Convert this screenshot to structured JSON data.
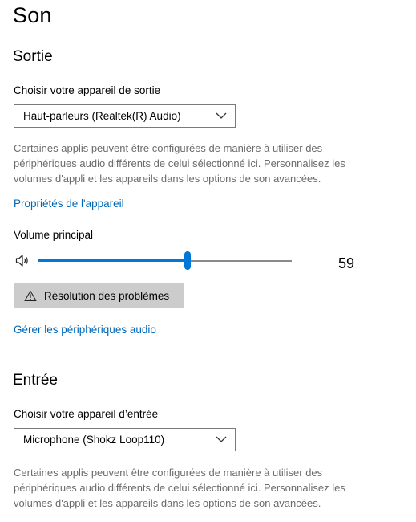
{
  "page": {
    "title": "Son"
  },
  "output": {
    "section_title": "Sortie",
    "device_label": "Choisir votre appareil de sortie",
    "device_value": "Haut-parleurs (Realtek(R) Audio)",
    "description": "Certaines applis peuvent être configurées de manière à utiliser des périphériques audio différents de celui sélectionné ici. Personnalisez les volumes d'appli et les appareils dans les options de son avancées.",
    "properties_link": "Propriétés de l'appareil",
    "volume_label": "Volume principal",
    "volume_value": "59",
    "volume_fraction": 0.59,
    "troubleshoot_label": "Résolution des problèmes",
    "manage_link": "Gérer les périphériques audio"
  },
  "input": {
    "section_title": "Entrée",
    "device_label": "Choisir votre appareil d’entrée",
    "device_value": "Microphone (Shokz Loop110)",
    "description": "Certaines applis peuvent être configurées de manière à utiliser des périphériques audio différents de celui sélectionné ici. Personnalisez les volumes d'appli et les appareils dans les options de son avancées."
  },
  "icons": {
    "speaker": "speaker-icon",
    "chevron": "chevron-down-icon",
    "warning": "warning-icon"
  },
  "colors": {
    "accent": "#0078d7",
    "link": "#0066b4",
    "description_text": "#6b6b6b",
    "button_bg": "#cccccc"
  }
}
